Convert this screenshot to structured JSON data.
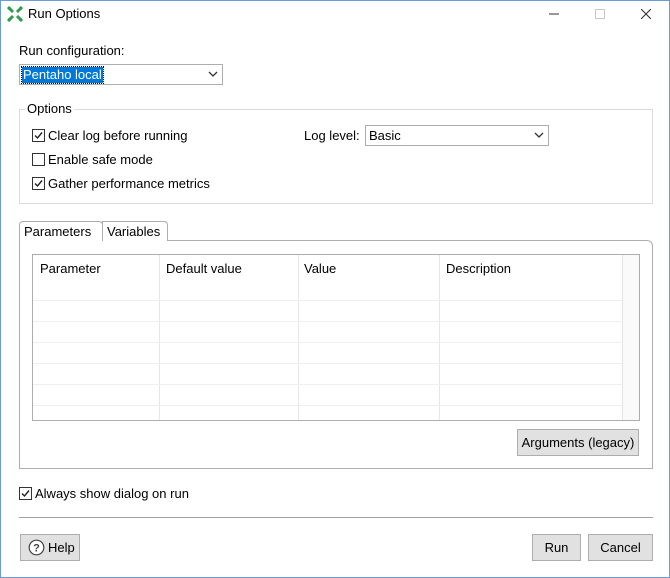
{
  "window": {
    "title": "Run Options"
  },
  "run_configuration": {
    "label": "Run configuration:",
    "value": "Pentaho local"
  },
  "options": {
    "legend": "Options",
    "clear_log": {
      "label": "Clear log before running",
      "checked": true
    },
    "safe_mode": {
      "label": "Enable safe mode",
      "checked": false
    },
    "gather_metrics": {
      "label": "Gather performance metrics",
      "checked": true
    },
    "log_level": {
      "label": "Log level:",
      "value": "Basic"
    }
  },
  "tabs": [
    {
      "label": "Parameters",
      "active": true
    },
    {
      "label": "Variables",
      "active": false
    }
  ],
  "parameters_table": {
    "columns": [
      "Parameter",
      "Default value",
      "Value",
      "Description"
    ],
    "rows": []
  },
  "arguments_button": "Arguments (legacy)",
  "always_show": {
    "label": "Always show dialog on run",
    "checked": true
  },
  "footer": {
    "help": "Help",
    "run": "Run",
    "cancel": "Cancel"
  },
  "colors": {
    "selection": "#0078d7",
    "app_icon": "#2e9d4f",
    "border": "#adadad"
  }
}
